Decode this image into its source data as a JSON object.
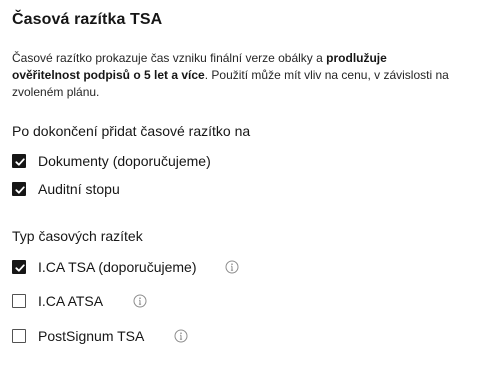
{
  "title": "Časová razítka TSA",
  "description": {
    "part1": "Časové razítko prokazuje čas vzniku finální verze obálky a ",
    "bold1": "prodlužuje",
    "bold2": "ověřitelnost podpisů o 5 let a více",
    "part2": ". Použití může mít vliv na cenu, v závislosti na zvoleném plánu."
  },
  "add_after": {
    "label": "Po dokončení přidat časové razítko na",
    "options": [
      {
        "label": "Dokumenty (doporučujeme)",
        "checked": true
      },
      {
        "label": "Auditní stopu",
        "checked": true
      }
    ]
  },
  "tsa_type": {
    "label": "Typ časových razítek",
    "options": [
      {
        "label": "I.CA TSA (doporučujeme)",
        "checked": true,
        "info_icon": "info-icon"
      },
      {
        "label": "I.CA ATSA",
        "checked": false,
        "info_icon": "info-icon"
      },
      {
        "label": "PostSignum TSA",
        "checked": false,
        "info_icon": "info-icon"
      }
    ]
  },
  "colors": {
    "text": "#161616",
    "checkbox_checked": "#161616",
    "info_icon": "#8d8d8d"
  }
}
